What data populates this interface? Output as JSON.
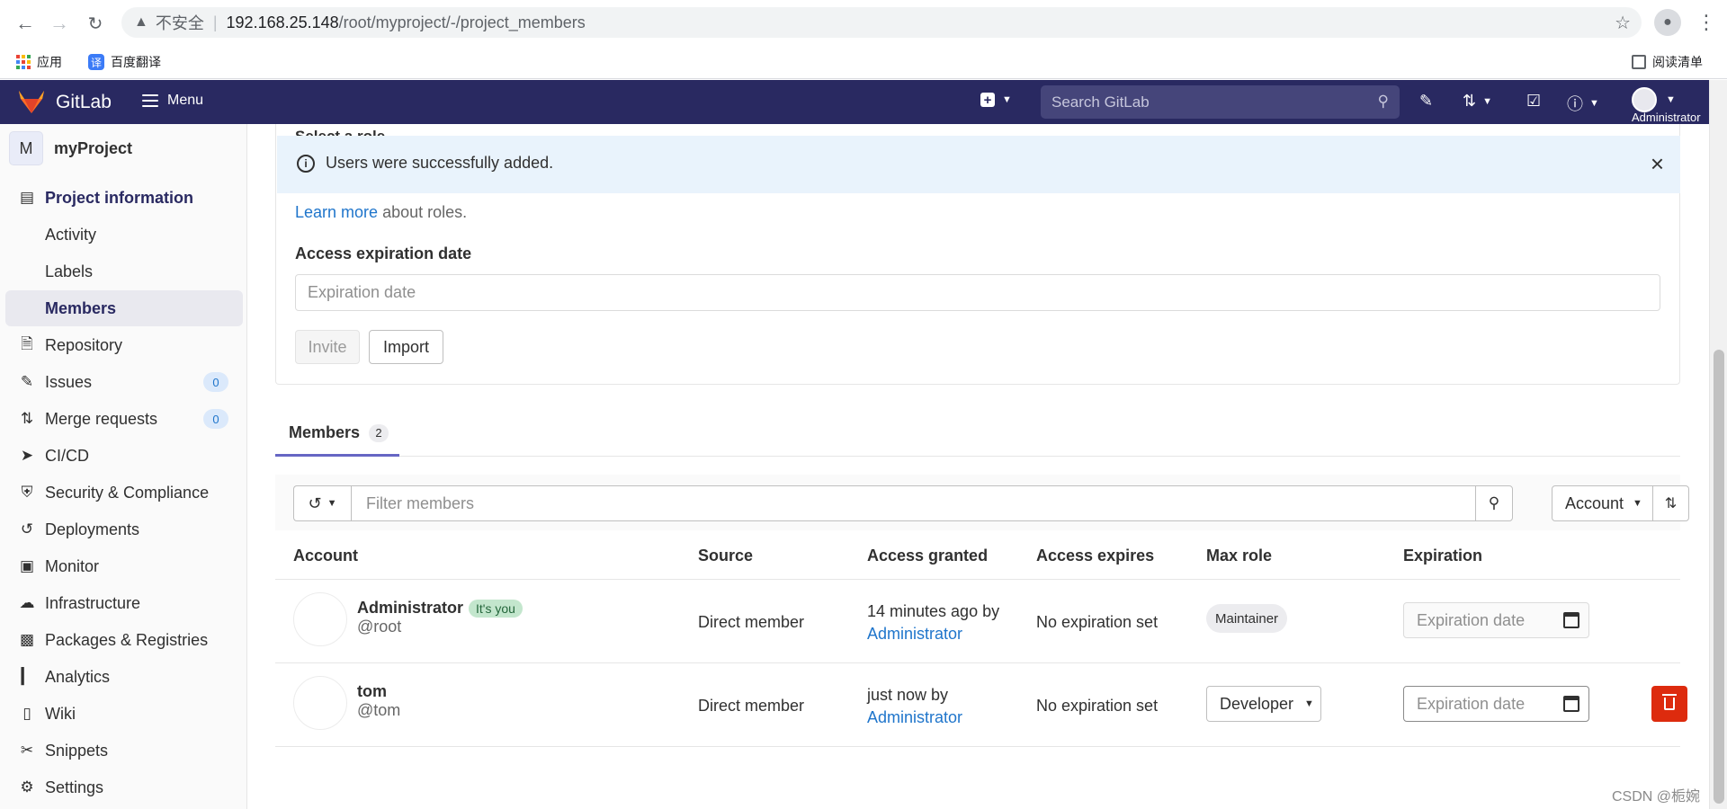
{
  "browser": {
    "security_label": "不安全",
    "url_host": "192.168.25.148",
    "url_path": "/root/myproject/-/project_members",
    "bookmarks": [
      {
        "label": "应用"
      },
      {
        "label": "百度翻译",
        "icon_text": "译"
      }
    ],
    "reading_list_label": "阅读清单"
  },
  "header": {
    "brand": "GitLab",
    "menu_label": "Menu",
    "search_placeholder": "Search GitLab",
    "user_caption": "Administrator",
    "bg_color": "#292961"
  },
  "sidebar": {
    "project_initial": "M",
    "project_name": "myProject",
    "items": [
      {
        "label": "Project information",
        "icon": "book-icon"
      },
      {
        "label": "Activity"
      },
      {
        "label": "Labels"
      },
      {
        "label": "Members"
      },
      {
        "label": "Repository",
        "icon": "doc-icon"
      },
      {
        "label": "Issues",
        "icon": "issues-icon",
        "badge": "0"
      },
      {
        "label": "Merge requests",
        "icon": "merge-icon",
        "badge": "0"
      },
      {
        "label": "CI/CD",
        "icon": "rocket-icon"
      },
      {
        "label": "Security & Compliance",
        "icon": "shield-icon"
      },
      {
        "label": "Deployments",
        "icon": "deploy-icon"
      },
      {
        "label": "Monitor",
        "icon": "monitor-icon"
      },
      {
        "label": "Infrastructure",
        "icon": "cloud-icon"
      },
      {
        "label": "Packages & Registries",
        "icon": "package-icon"
      },
      {
        "label": "Analytics",
        "icon": "chart-icon"
      },
      {
        "label": "Wiki",
        "icon": "wiki-icon"
      },
      {
        "label": "Snippets",
        "icon": "scissors-icon"
      },
      {
        "label": "Settings",
        "icon": "gear-icon"
      }
    ]
  },
  "invite": {
    "clipped_label": "Select a role",
    "alert_message": "Users were successfully added.",
    "learn_more_link": "Learn more",
    "learn_more_rest": " about roles.",
    "expiration_label": "Access expiration date",
    "expiration_placeholder": "Expiration date",
    "invite_button": "Invite",
    "import_button": "Import"
  },
  "tabs": {
    "members_label": "Members",
    "members_count": "2"
  },
  "filter": {
    "placeholder": "Filter members",
    "sort_label": "Account"
  },
  "table": {
    "headers": {
      "account": "Account",
      "source": "Source",
      "granted": "Access granted",
      "expires": "Access expires",
      "max_role": "Max role",
      "expiration": "Expiration"
    },
    "rows": [
      {
        "name": "Administrator",
        "tag": "It's you",
        "handle": "@root",
        "source": "Direct member",
        "granted_time": "14 minutes ago by",
        "granted_by": "Administrator",
        "expires": "No expiration set",
        "role": "Maintainer",
        "expiration_placeholder": "Expiration date"
      },
      {
        "name": "tom",
        "handle": "@tom",
        "source": "Direct member",
        "granted_time": "just now by",
        "granted_by": "Administrator",
        "expires": "No expiration set",
        "role": "Developer",
        "expiration_placeholder": "Expiration date"
      }
    ]
  },
  "watermark": "CSDN @栀婉"
}
